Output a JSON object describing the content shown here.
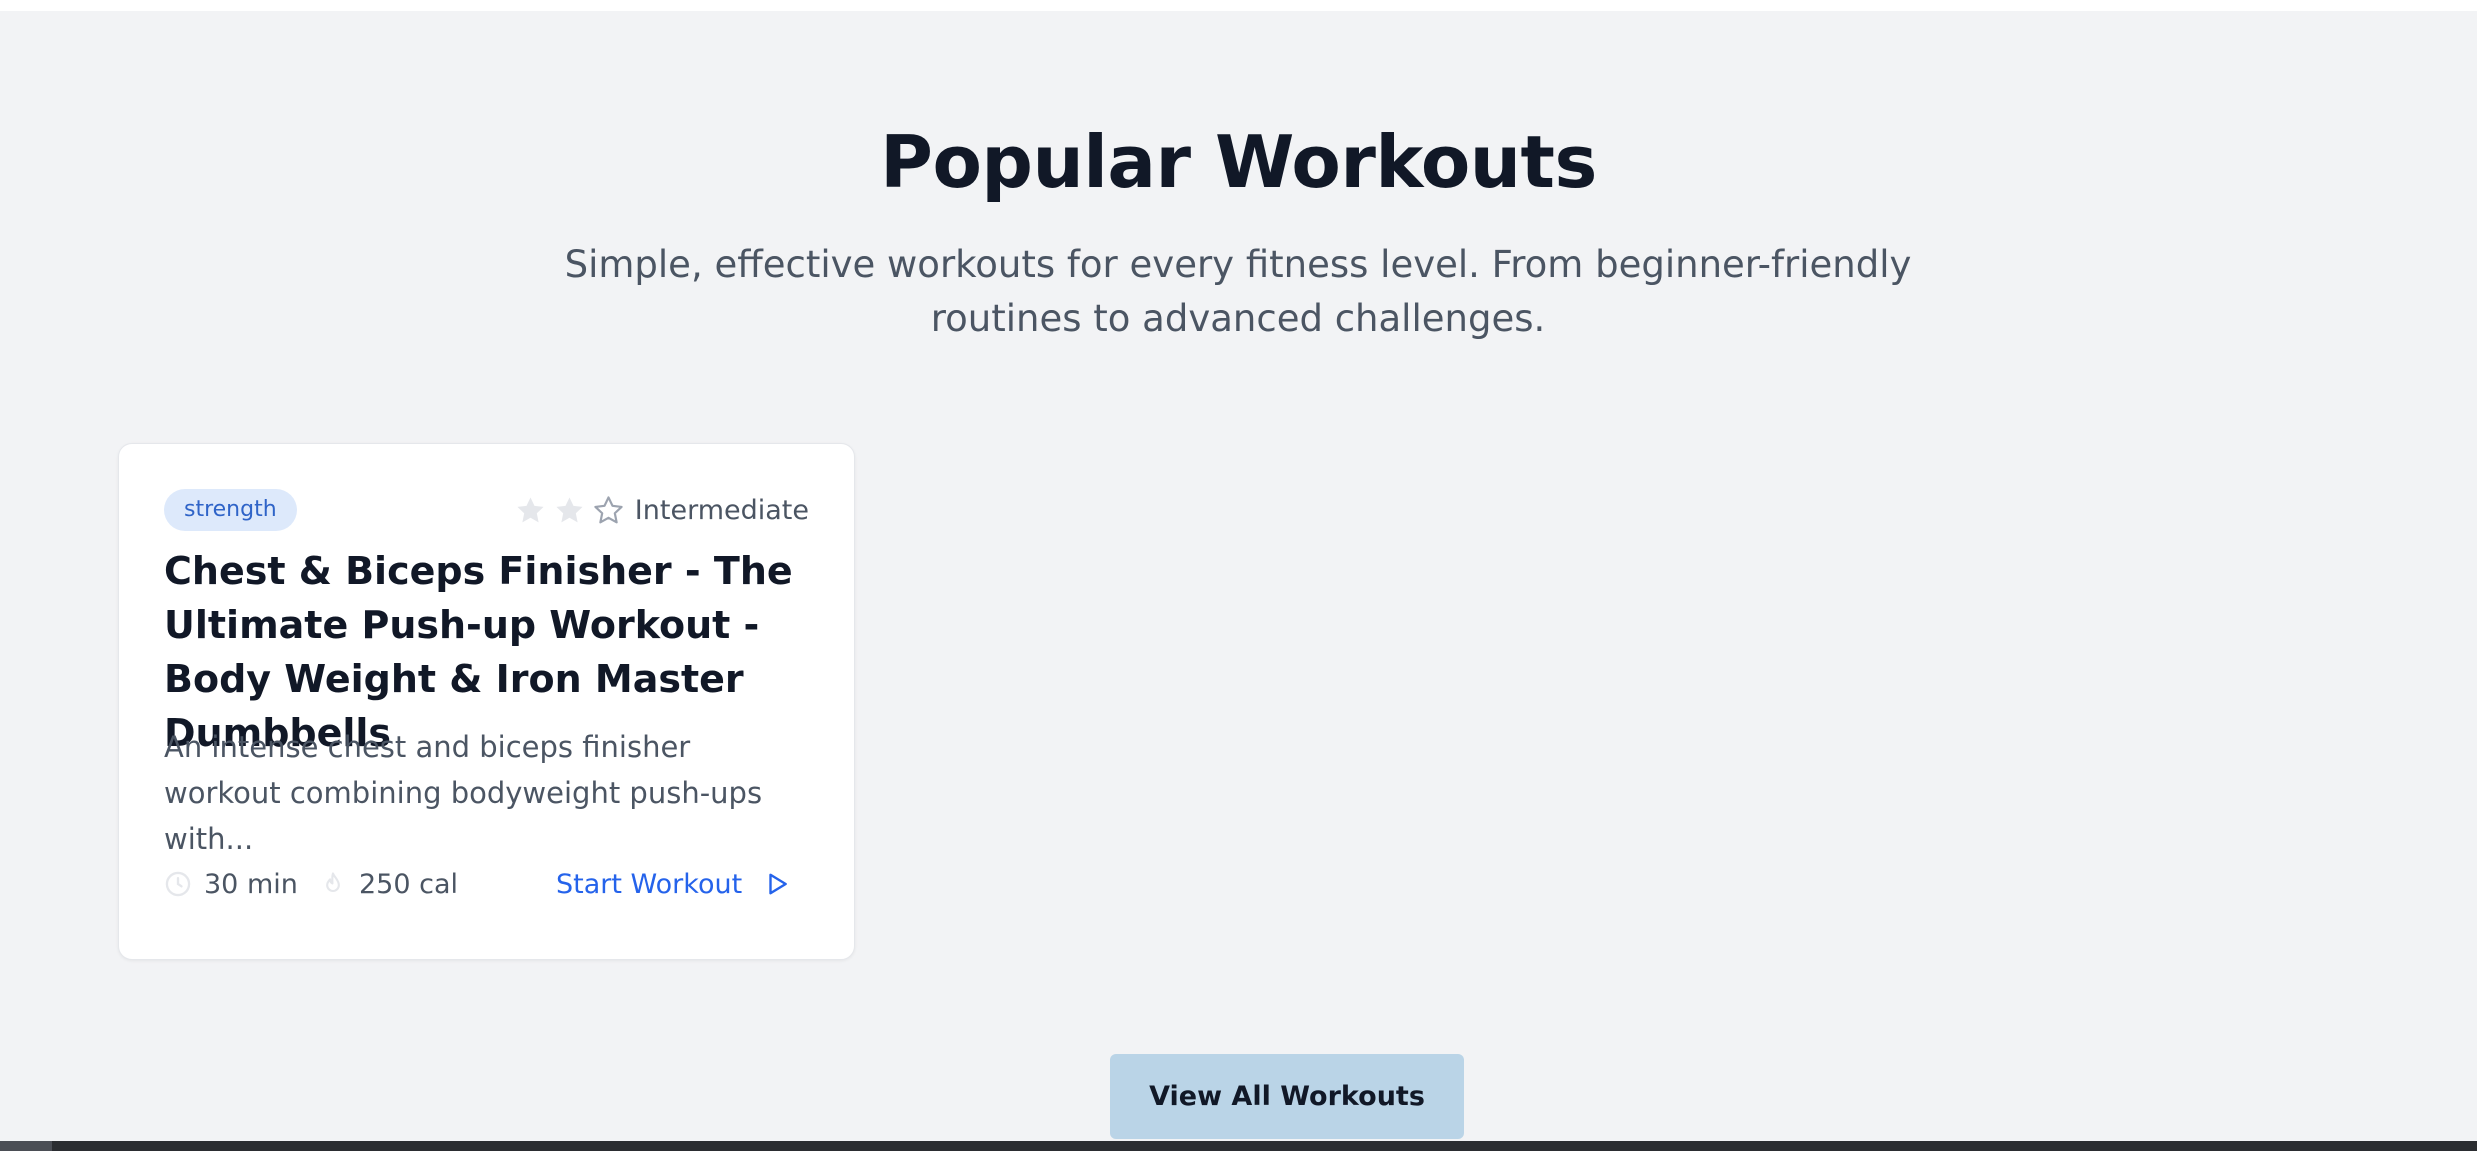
{
  "section": {
    "title": "Popular Workouts",
    "subtitle": "Simple, effective workouts for every fitness level. From beginner-friendly routines to advanced challenges."
  },
  "workout_card": {
    "category": "strength",
    "difficulty": "Intermediate",
    "difficulty_stars": {
      "filled": 2,
      "total": 3
    },
    "title": "Chest & Biceps Finisher - The Ultimate Push-up Workout - Body Weight & Iron Master Dumbbells",
    "description": "An intense chest and biceps finisher workout combining bodyweight push-ups with...",
    "duration": "30 min",
    "calories": "250 cal",
    "start_label": "Start Workout",
    "icons": [
      "star-icon",
      "clock-icon",
      "flame-icon",
      "play-icon"
    ]
  },
  "view_all_label": "View All Workouts",
  "colors": {
    "page_background": "#f2f3f5",
    "accent_blue": "#2563eb",
    "tag_background": "#dde9fb",
    "button_background": "#bad4e7",
    "heading_text": "#111827",
    "body_text": "#4b5563"
  }
}
